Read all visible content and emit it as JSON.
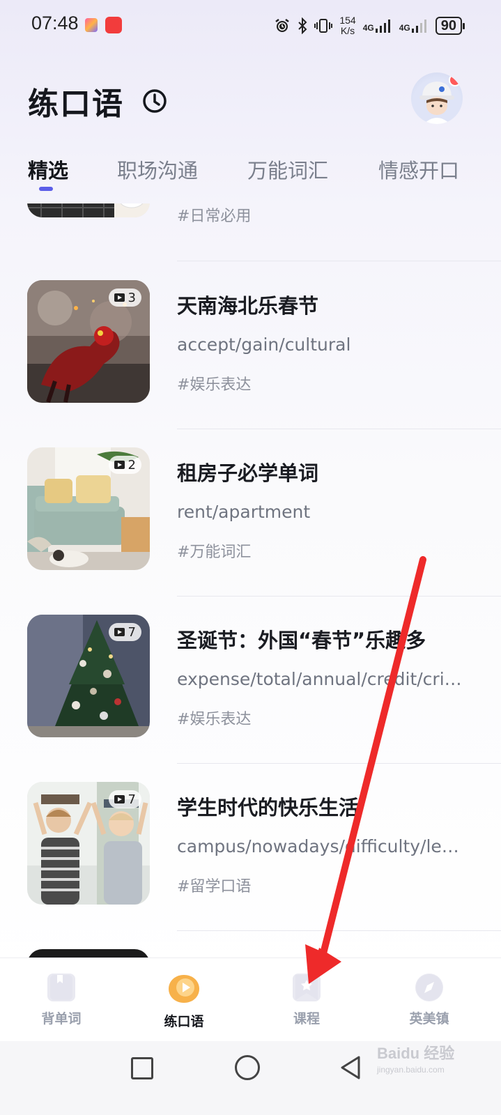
{
  "status_bar": {
    "time": "07:48",
    "net_speed_value": "154",
    "net_speed_unit": "K/s",
    "signal1": "4G",
    "signal2": "4G",
    "battery": "90"
  },
  "header": {
    "title": "练口语",
    "history_icon": "clock-icon"
  },
  "tabs": [
    {
      "label": "精选",
      "active": true
    },
    {
      "label": "职场沟通",
      "active": false
    },
    {
      "label": "万能词汇",
      "active": false
    },
    {
      "label": "情感开口",
      "active": false
    }
  ],
  "items": [
    {
      "title": "",
      "words": "",
      "tag": "#日常必用",
      "count": ""
    },
    {
      "title": "天南海北乐春节",
      "words": "accept/gain/cultural",
      "tag": "#娱乐表达",
      "count": "3"
    },
    {
      "title": "租房子必学单词",
      "words": "rent/apartment",
      "tag": "#万能词汇",
      "count": "2"
    },
    {
      "title": "圣诞节：外国“春节”乐趣多",
      "words": "expense/total/annual/credit/cri…",
      "tag": "#娱乐表达",
      "count": "7"
    },
    {
      "title": "学生时代的快乐生活",
      "words": "campus/nowadays/difficulty/le…",
      "tag": "#留学口语",
      "count": "7"
    }
  ],
  "bottom_nav": [
    {
      "label": "背单词",
      "icon": "bookmark-icon",
      "active": false
    },
    {
      "label": "练口语",
      "icon": "play-bubble-icon",
      "active": true
    },
    {
      "label": "课程",
      "icon": "star-bookmark-icon",
      "active": false
    },
    {
      "label": "英美镇",
      "icon": "compass-icon",
      "active": false
    }
  ],
  "watermark": {
    "brand": "Baidu 经验",
    "url": "jingyan.baidu.com"
  },
  "colors": {
    "accent": "#5b5ee8",
    "annotation_arrow": "#ee2a2a",
    "active_nav": "#f5a623"
  }
}
